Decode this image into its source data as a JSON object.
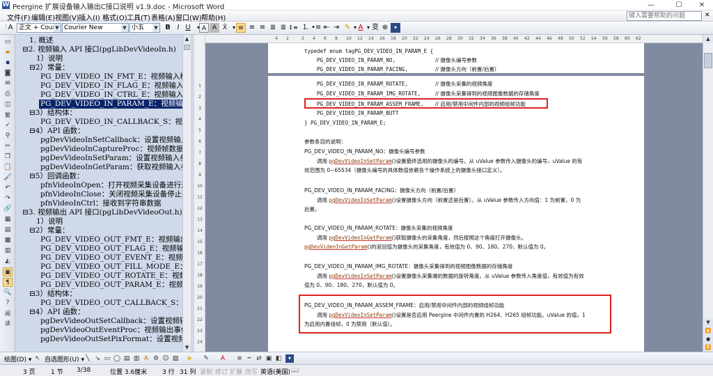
{
  "window": {
    "title": "Peergine 扩展设备输入输出C接口说明 v1.9.doc - Microsoft Word",
    "app_icon_label": "W"
  },
  "menu": {
    "items": [
      "文件(F)",
      "编辑(E)",
      "视图(V)",
      "插入(I)",
      "格式(O)",
      "工具(T)",
      "表格(A)",
      "窗口(W)",
      "帮助(H)"
    ],
    "help_placeholder": "键入需要帮助的问题"
  },
  "toolbar": {
    "style": "正文 + Courie",
    "font": "Courier New",
    "size": "小五",
    "bold": "B",
    "italic": "I",
    "underline": "U"
  },
  "outline": {
    "items": [
      "1. 概述",
      "⊟2. 视频输入 API 接口(pgLibDevVideoIn.h)",
      "1）说明",
      "⊟2）常量：",
      "PG_DEV_VIDEO_IN_FMT_E：视频输入格式",
      "PG_DEV_VIDEO_IN_FLAG_E：视频输入标志位",
      "PG_DEV_VIDEO_IN_CTRL_E：视频输入控制命令",
      "PG_DEV_VIDEO_IN_PARAM_E：视频输入参数的",
      "⊟3）结构体：",
      "PG_DEV_VIDEO_IN_CALLBACK_S：视频输入回",
      "⊟4）API 函数：",
      "pgDevVideoInSetCallback：设置视频输入回调接口",
      "pgDevVideoInCaptureProc：视频帧数据输入",
      "pgDevVideoInSetParam：设置视频输入参数",
      "pgDevVideoInGetParam：获取视频输入参数",
      "⊟5）回调函数：",
      "pfnVideoInOpen：打开视频采集设备进行采集",
      "pfnVideoInClose：关闭视频采集设备停止采集",
      "pfnVideoInCtrl：接收到字符串数据",
      "⊟3. 视频输出 API 接口(pgLibDevVideoOut.h)",
      "1）说明",
      "⊟2）常量：",
      "PG_DEV_VIDEO_OUT_FMT_E：视频输出格式",
      "PG_DEV_VIDEO_OUT_FLAG_E：视频输出标志位",
      "PG_DEV_VIDEO_OUT_EVENT_E：视频输出事件",
      "PG_DEV_VIDEO_OUT_FILL_MODE_E：视频输出",
      "PG_DEV_VIDEO_OUT_ROTATE_E：视频输出旋转",
      "PG_DEV_VIDEO_OUT_PARAM_E：视频输出参数",
      "⊟3）结构体：",
      "PG_DEV_VIDEO_OUT_CALLBACK_S：视频输出",
      "⊟4）API 函数：",
      "pgDevVideoOutSetCallback：设置视频输出回调接口",
      "pgDevVideoOutEventProc：视频输出事件处理",
      "pgDevVideoOutSetPixFormat：设置视频输出的像素"
    ]
  },
  "document": {
    "code": {
      "typedef_line": "typedef enum tagPG_DEV_VIDEO_IN_PARAM_E {",
      "enum_no": "PG_DEV_VIDEO_IN_PARAM_NO,",
      "enum_no_comment": "// 摄像头编号参数",
      "enum_facing": "PG_DEV_VIDEO_IN_PARAM_FACING,",
      "enum_facing_comment": "// 摄像头方向（前置/后置）",
      "enum_rotate": "PG_DEV_VIDEO_IN_PARAM_ROTATE,",
      "enum_rotate_comment": "// 摄像头采集的视频角度",
      "enum_img_rotate": "PG_DEV_VIDEO_IN_PARAM_IMG_ROTATE,",
      "enum_img_rotate_comment": "// 摄像头采集得到的视频图像数据的存储角度",
      "enum_assem": "PG_DEV_VIDEO_IN_PARAM_ASSEM_FRAME,",
      "enum_assem_comment": "// 启用/禁用中间件内部的视频组帧功能",
      "enum_butt": "PG_DEV_VIDEO_IN_PARAM_BUTT",
      "close_line": "} PG_DEV_VIDEO_IN_PARAM_E;"
    },
    "param_heading": "参数条目的说明：",
    "p_no_title": "PG_DEV_VIDEO_IN_PARAM_NO：摄像头编号参数",
    "p_no_l1a": "调用 ",
    "p_no_fn": "pgDevVideoInSetParam",
    "p_no_l1b": "()设置最终选用的摄像头的编号。从 uValue 参数传入摄像头的编号，uValue 的有",
    "p_no_l2": "效范围为 0~65534（摄像头编号的具体数值依赖各个操作系统上的摄像头接口定义）。",
    "p_facing_title": "PG_DEV_VIDEO_IN_PARAM_FACING：摄像头方向（前置/后置）",
    "p_facing_l1a": "调用 ",
    "p_facing_fn": "pgDevVideoInSetParam",
    "p_facing_l1b": "()设置摄像头方向（前置还是后置）。从 uValue 参数传入方向值：1 为前置，0 为",
    "p_facing_l2": "后置。",
    "p_rotate_title": "PG_DEV_VIDEO_IN_PARAM_ROTATE：摄像头采集的视频角度",
    "p_rotate_l1a": "调用 ",
    "p_rotate_fn": "pgDevVideoInGetParam",
    "p_rotate_l1b": "()获取摄像头的采集角度，然后按照这个角度打开摄像头。",
    "p_rotate_l2a": "pgDevVideoInGetParam",
    "p_rotate_l2b": "()的返回值为摄像头的采集角度，有效值为 0、90、180、270，默认值为 0。",
    "p_img_title": "PG_DEV_VIDEO_IN_PARAM_IMG_ROTATE：摄像头采集得到的视频图像数据的存储角度",
    "p_img_l1a": "调用 ",
    "p_img_fn": "pgDevVideoInSetParam",
    "p_img_l1b": "()设置摄像头采集端的数据的旋转角度。从 uValue 参数传入角度值，有效值为有效",
    "p_img_l2": "值为 0、90、180、270，默认值为 0。",
    "p_assem_title": "PG_DEV_VIDEO_IN_PARAM_ASSEM_FRAME：启用/禁用中间件内部的视频组帧功能",
    "p_assem_l1a": "调用 ",
    "p_assem_fn": "pgDevVideoInSetParam",
    "p_assem_l1b": "()设置是否启用 Peergine 中间件内置的 H264、H265 组帧功能。uValue 的值，1",
    "p_assem_l2": "为启用内置组帧，0 为禁用（默认值）。"
  },
  "drawbar": {
    "draw_label": "绘图(D) ▾",
    "autoshape_label": "自选图形(U) ▾"
  },
  "status": {
    "page": "3 页",
    "section": "1 节",
    "page_of": "3/38",
    "position": "位置 3.6厘米",
    "line": "3 行",
    "column": "31 列",
    "rec": "录制",
    "trk": "修订",
    "ext": "扩展",
    "ovr": "改写",
    "language": "英语(美国)"
  },
  "colors": {
    "highlight_box": "#e02020",
    "selection": "#0a246a",
    "outline_bg": "#cfd9ea"
  }
}
